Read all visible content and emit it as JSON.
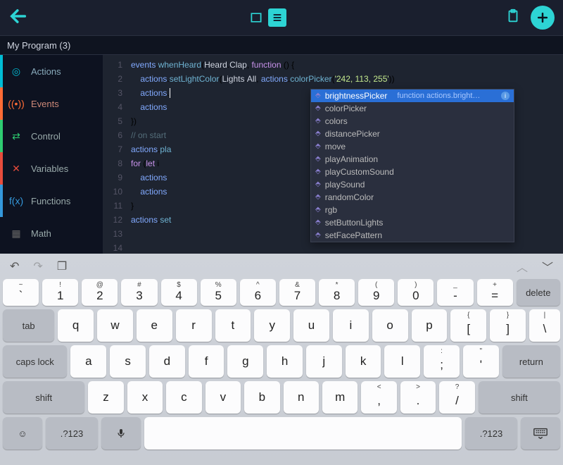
{
  "header": {
    "title": "My Program (3)"
  },
  "sidebar": {
    "items": [
      {
        "label": "Actions",
        "cls": "actions",
        "icon": "◎"
      },
      {
        "label": "Events",
        "cls": "events",
        "icon": "((•))"
      },
      {
        "label": "Control",
        "cls": "control",
        "icon": "⇄"
      },
      {
        "label": "Variables",
        "cls": "variables",
        "icon": "✕"
      },
      {
        "label": "Functions",
        "cls": "functions",
        "icon": "f(x)"
      },
      {
        "label": "Math",
        "cls": "math",
        "icon": "▦"
      }
    ]
  },
  "editor": {
    "line_numbers": [
      "1",
      "2",
      "3",
      "4",
      "5",
      "6",
      "7",
      "8",
      "9",
      "10",
      "11",
      "12",
      "13",
      "14"
    ],
    "lines": [
      "events.whenHeard(Heard.Clap, function () {",
      "    actions.setLightColor(Lights.All, actions.colorPicker('242, 113, 255'))",
      "    actions.",
      "    actions",
      "})",
      "// on start",
      "",
      "actions.pla",
      "for (let i",
      "    actions",
      "    actions",
      "}",
      "actions.set",
      ""
    ]
  },
  "autocomplete": {
    "selected_index": 0,
    "hint": "function actions.bright…",
    "items": [
      "brightnessPicker",
      "colorPicker",
      "colors",
      "distancePicker",
      "move",
      "playAnimation",
      "playCustomSound",
      "playSound",
      "randomColor",
      "rgb",
      "setButtonLights",
      "setFacePattern"
    ]
  },
  "keyboard": {
    "row1": [
      {
        "top": "~",
        "bot": "`"
      },
      {
        "top": "!",
        "bot": "1"
      },
      {
        "top": "@",
        "bot": "2"
      },
      {
        "top": "#",
        "bot": "3"
      },
      {
        "top": "$",
        "bot": "4"
      },
      {
        "top": "%",
        "bot": "5"
      },
      {
        "top": "^",
        "bot": "6"
      },
      {
        "top": "&",
        "bot": "7"
      },
      {
        "top": "*",
        "bot": "8"
      },
      {
        "top": "(",
        "bot": "9"
      },
      {
        "top": ")",
        "bot": "0"
      },
      {
        "top": "_",
        "bot": "-"
      },
      {
        "top": "+",
        "bot": "="
      }
    ],
    "delete": "delete",
    "row2": [
      "q",
      "w",
      "e",
      "r",
      "t",
      "y",
      "u",
      "i",
      "o",
      "p"
    ],
    "row2b": [
      {
        "top": "{",
        "bot": "["
      },
      {
        "top": "}",
        "bot": "]"
      },
      {
        "top": "|",
        "bot": "\\"
      }
    ],
    "tab": "tab",
    "row3": [
      "a",
      "s",
      "d",
      "f",
      "g",
      "h",
      "j",
      "k",
      "l"
    ],
    "row3b": [
      {
        "top": ":",
        "bot": ";"
      },
      {
        "top": "\"",
        "bot": "'"
      }
    ],
    "caps": "caps lock",
    "return": "return",
    "row4": [
      "z",
      "x",
      "c",
      "v",
      "b",
      "n",
      "m"
    ],
    "row4b": [
      {
        "top": "<",
        "bot": ","
      },
      {
        "top": ">",
        "bot": "."
      },
      {
        "top": "?",
        "bot": "/"
      }
    ],
    "shift": "shift",
    "sym": ".?123"
  }
}
